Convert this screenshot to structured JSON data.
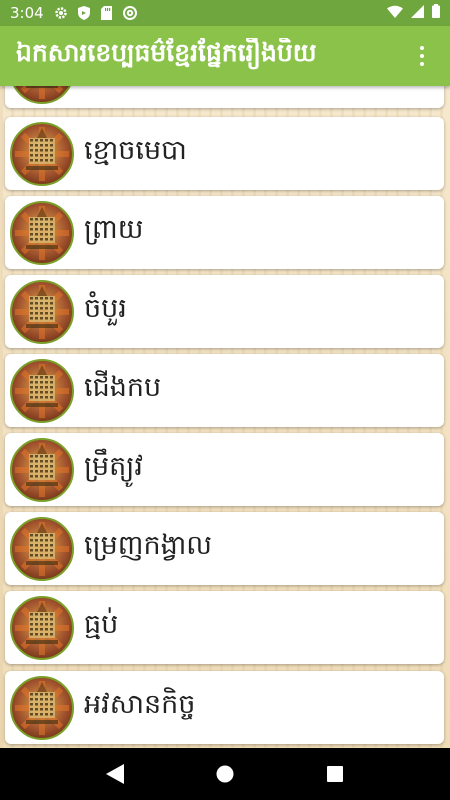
{
  "status_bar": {
    "time": "3:04",
    "icons": [
      "settings-icon",
      "shield-icon",
      "sd-card-icon",
      "at-sign-icon",
      "wifi-icon",
      "signal-icon",
      "battery-icon"
    ]
  },
  "app_bar": {
    "title": "ឯកសារខេប្បធម៌ខ្មែរផ្នែករឿងបិយ",
    "menu_icon": "more-vert-icon"
  },
  "colors": {
    "status_bar": "#6fa63d",
    "app_bar": "#8bc34a",
    "thumb_border": "#7aa02a",
    "background": "#f3e3c4"
  },
  "list": {
    "items": [
      {
        "label": ""
      },
      {
        "label": "ខ្មោចមេបា"
      },
      {
        "label": "ព្រាយ"
      },
      {
        "label": "ចំបួរ"
      },
      {
        "label": "ជើងកប"
      },
      {
        "label": "ម្រឹត្យូវ"
      },
      {
        "label": "ម្រេញកង្វាល"
      },
      {
        "label": "ធ្មប់"
      },
      {
        "label": "អវសានកិច្ច"
      }
    ]
  },
  "nav_bar": {
    "buttons": [
      "back-icon",
      "home-icon",
      "recents-icon"
    ]
  }
}
